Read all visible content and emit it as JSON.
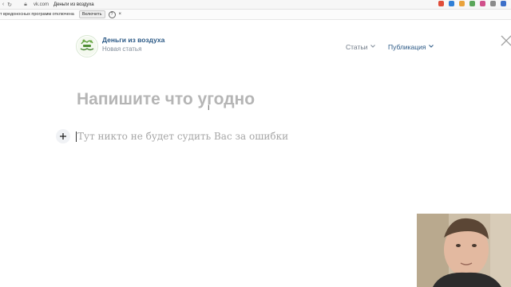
{
  "browser": {
    "url": "vk.com",
    "tab_title": "Деньги из воздуха"
  },
  "infobar": {
    "message": "т вредоносных программ отключена",
    "enable_label": "Включить",
    "help_symbol": "?",
    "close_symbol": "×"
  },
  "header": {
    "group_name": "Деньги из воздуха",
    "subtitle": "Новая статья",
    "logo_text": "ДЕНЬГИ"
  },
  "menu": {
    "articles_label": "Статьи",
    "publish_label": "Публикация"
  },
  "editor": {
    "title_placeholder": "Напишите что угодно",
    "body_placeholder": "Тут никто не будет судить Вас за ошибки"
  },
  "colors": {
    "link_blue": "#2a5885",
    "muted_gray": "#818c99",
    "placeholder_gray": "#b5b5b5"
  }
}
